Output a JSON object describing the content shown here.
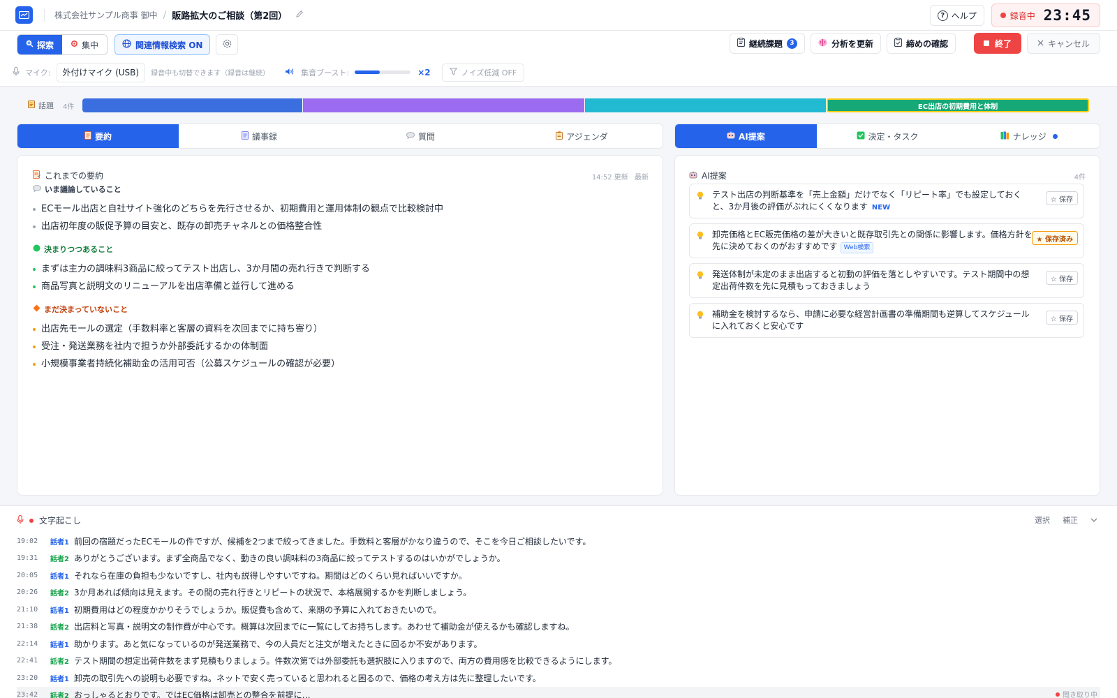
{
  "header": {
    "client": "株式会社サンプル商事 御中",
    "separator": "/",
    "meeting_title": "販路拡大のご相談（第2回）",
    "help_label": "ヘルプ",
    "rec_label": "録音中",
    "rec_time": "23:45"
  },
  "toolbar": {
    "mode_explore": "探索",
    "mode_focus": "集中",
    "related_search": "関連情報検索 ON",
    "carryover_label": "継続課題",
    "carryover_count": "3",
    "refresh_label": "分析を更新",
    "closing_label": "締めの確認",
    "end_label": "終了",
    "cancel_label": "キャンセル"
  },
  "mic": {
    "label": "マイク:",
    "device": "外付けマイク (USB)",
    "hint": "録音中も切替できます（録音は継続）",
    "boost_label": "集音ブースト:",
    "boost_level": 0.45,
    "boost_value": "×2",
    "noise_label": "ノイズ低減 OFF"
  },
  "topics": {
    "label": "話題",
    "count": "4件",
    "segments": [
      {
        "color": "#3b6fe0",
        "weight": 310,
        "label": ""
      },
      {
        "color": "#9b6cf0",
        "weight": 396,
        "label": ""
      },
      {
        "color": "#22b9d3",
        "weight": 340,
        "label": ""
      },
      {
        "color": "#16a876",
        "weight": 366,
        "label": "EC出店の初期費用と体制"
      }
    ]
  },
  "left_tabs": {
    "summary": "要約",
    "minutes": "議事録",
    "questions": "質問",
    "agenda": "アジェンダ"
  },
  "summary": {
    "title": "これまでの要約",
    "updated": "14:52 更新",
    "latest": "最新",
    "discussing": {
      "title": "いま議論していること",
      "items": [
        "ECモール出店と自社サイト強化のどちらを先行させるか、初期費用と運用体制の観点で比較検討中",
        "出店初年度の販促予算の目安と、既存の卸売チャネルとの価格整合性"
      ]
    },
    "deciding": {
      "title": "決まりつつあること",
      "items": [
        "まずは主力の調味料3商品に絞ってテスト出店し、3か月間の売れ行きで判断する",
        "商品写真と説明文のリニューアルを出店準備と並行して進める"
      ]
    },
    "undecided": {
      "title": "まだ決まっていないこと",
      "items": [
        "出店先モールの選定（手数料率と客層の資料を次回までに持ち寄り）",
        "受注・発送業務を社内で担うか外部委託するかの体制面",
        "小規模事業者持続化補助金の活用可否（公募スケジュールの確認が必要）"
      ]
    }
  },
  "right_tabs": {
    "ai": "AI提案",
    "decisions": "決定・タスク",
    "knowledge": "ナレッジ"
  },
  "ai": {
    "title": "AI提案",
    "count": "4件",
    "cards": [
      {
        "text": "テスト出店の判断基準を「売上金額」だけでなく「リピート率」でも設定しておくと、3か月後の評価がぶれにくくなります",
        "tag": "NEW",
        "web": "",
        "save": "☆ 保存",
        "saved": false
      },
      {
        "text": "卸売価格とEC販売価格の差が大きいと既存取引先との関係に影響します。価格方針を先に決めておくのがおすすめです",
        "tag": "",
        "web": "Web検索",
        "save": "★ 保存済み",
        "saved": true
      },
      {
        "text": "発送体制が未定のまま出店すると初動の評価を落としやすいです。テスト期間中の想定出荷件数を先に見積もっておきましょう",
        "tag": "",
        "web": "",
        "save": "☆ 保存",
        "saved": false
      },
      {
        "text": "補助金を検討するなら、申請に必要な経営計画書の準備期間も逆算してスケジュールに入れておくと安心です",
        "tag": "",
        "web": "",
        "save": "☆ 保存",
        "saved": false
      }
    ]
  },
  "transcript": {
    "title": "文字起こし",
    "select": "選択",
    "correct": "補正",
    "listening": "聞き取り中",
    "rows": [
      {
        "time": "19:02",
        "speaker": "話者1",
        "text": "前回の宿題だったECモールの件ですが、候補を2つまで絞ってきました。手数料と客層がかなり違うので、そこを今日ご相談したいです。"
      },
      {
        "time": "19:31",
        "speaker": "話者2",
        "text": "ありがとうございます。まず全商品でなく、動きの良い調味料の3商品に絞ってテストするのはいかがでしょうか。"
      },
      {
        "time": "20:05",
        "speaker": "話者1",
        "text": "それなら在庫の負担も少ないですし、社内も説得しやすいですね。期間はどのくらい見ればいいですか。"
      },
      {
        "time": "20:26",
        "speaker": "話者2",
        "text": "3か月あれば傾向は見えます。その間の売れ行きとリピートの状況で、本格展開するかを判断しましょう。"
      },
      {
        "time": "21:10",
        "speaker": "話者1",
        "text": "初期費用はどの程度かかりそうでしょうか。販促費も含めて、来期の予算に入れておきたいので。"
      },
      {
        "time": "21:38",
        "speaker": "話者2",
        "text": "出店料と写真・説明文の制作費が中心です。概算は次回までに一覧にしてお持ちします。あわせて補助金が使えるかも確認しますね。"
      },
      {
        "time": "22:14",
        "speaker": "話者1",
        "text": "助かります。あと気になっているのが発送業務で、今の人員だと注文が増えたときに回るか不安があります。"
      },
      {
        "time": "22:41",
        "speaker": "話者2",
        "text": "テスト期間の想定出荷件数をまず見積もりましょう。件数次第では外部委託も選択肢に入りますので、両方の費用感を比較できるようにします。"
      },
      {
        "time": "23:20",
        "speaker": "話者1",
        "text": "卸売の取引先への説明も必要ですね。ネットで安く売っていると思われると困るので、価格の考え方は先に整理したいです。"
      },
      {
        "time": "23:42",
        "speaker": "話者2",
        "text": "おっしゃるとおりです。ではEC価格は卸売との整合を前提に…"
      }
    ]
  },
  "colors": {
    "accent": "#2563eb",
    "speaker1": "#2563eb",
    "speaker2": "#16a34a",
    "danger": "#ef4444"
  }
}
